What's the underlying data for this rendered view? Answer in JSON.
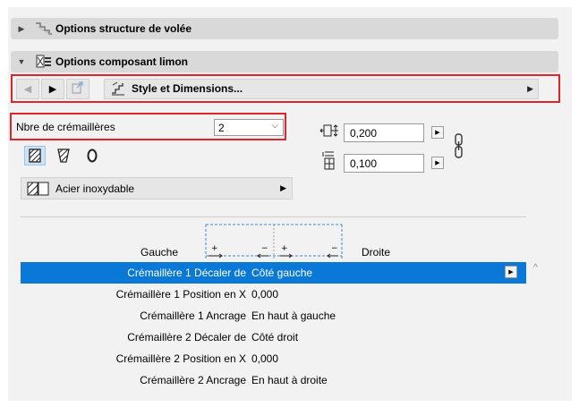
{
  "sections": {
    "structure": {
      "label": "Options structure de volée",
      "expanded": false,
      "icon": "stair-structure-icon"
    },
    "stringer": {
      "label": "Options composant limon",
      "expanded": true,
      "icon": "stringer-component-icon"
    }
  },
  "nav": {
    "prev": "◀",
    "next": "▶",
    "style_label": "Style et Dimensions...",
    "dd_arrow": "▶"
  },
  "stringer_count": {
    "label": "Nbre de crémaillères",
    "value": "2",
    "chevron": "⌵"
  },
  "dimensions": {
    "width_value": "0,200",
    "height_value": "0,100",
    "btn": "▶"
  },
  "shapes": [
    "hatched-rectangle-icon",
    "tapered-profile-icon",
    "round-profile-icon"
  ],
  "material": {
    "label": "Acier inoxydable",
    "dd_arrow": "▶",
    "icon": "material-swatch-icon"
  },
  "layout_header": {
    "left": "Gauche",
    "right": "Droite"
  },
  "table": {
    "row_button": "▶",
    "rows": [
      {
        "name": "Crémaillère 1 Décaler de",
        "value": "Côté gauche",
        "selected": true
      },
      {
        "name": "Crémaillère 1 Position en X",
        "value": "0,000",
        "selected": false
      },
      {
        "name": "Crémaillère 1 Ancrage",
        "value": "En haut à gauche",
        "selected": false
      },
      {
        "name": "Crémaillère 2 Décaler de",
        "value": "Côté droit",
        "selected": false
      },
      {
        "name": "Crémaillère 2 Position en X",
        "value": "0,000",
        "selected": false
      },
      {
        "name": "Crémaillère 2 Ancrage",
        "value": "En haut à droite",
        "selected": false
      }
    ]
  },
  "scroll": {
    "up": "^"
  },
  "colors": {
    "highlight": "#e0242c",
    "selection": "#0a78d7",
    "section_bar": "#d9d9d9"
  }
}
